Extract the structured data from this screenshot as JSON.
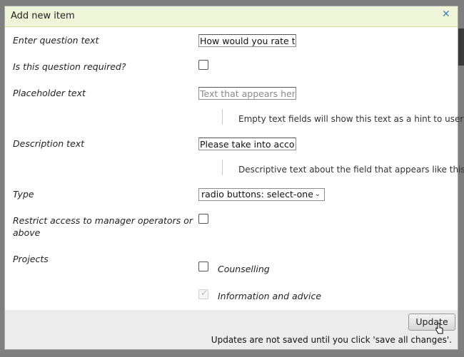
{
  "dialog": {
    "title": "Add new item",
    "close_icon": "close-icon"
  },
  "fields": {
    "question_text": {
      "label": "Enter question text",
      "value": "How would you rate the"
    },
    "required": {
      "label": "Is this question required?",
      "checked": false
    },
    "placeholder": {
      "label": "Placeholder text",
      "placeholder": "Text that appears here",
      "hint": "Empty text fields will show this text as a hint to users."
    },
    "description": {
      "label": "Description text",
      "value": "Please take into accour",
      "hint": "Descriptive text about the field that appears like this."
    },
    "type": {
      "label": "Type",
      "selected": "radio buttons: select-one"
    },
    "restrict": {
      "label_line1": "Restrict access to manager operators or",
      "label_line2": "above",
      "checked": false
    },
    "projects": {
      "label": "Projects",
      "items": [
        {
          "label": "Counselling",
          "checked": false,
          "disabled": false
        },
        {
          "label": "Information and advice",
          "checked": true,
          "disabled": true
        }
      ]
    }
  },
  "footer": {
    "update_label": "Update",
    "note": "Updates are not saved until you click 'save all changes'."
  }
}
